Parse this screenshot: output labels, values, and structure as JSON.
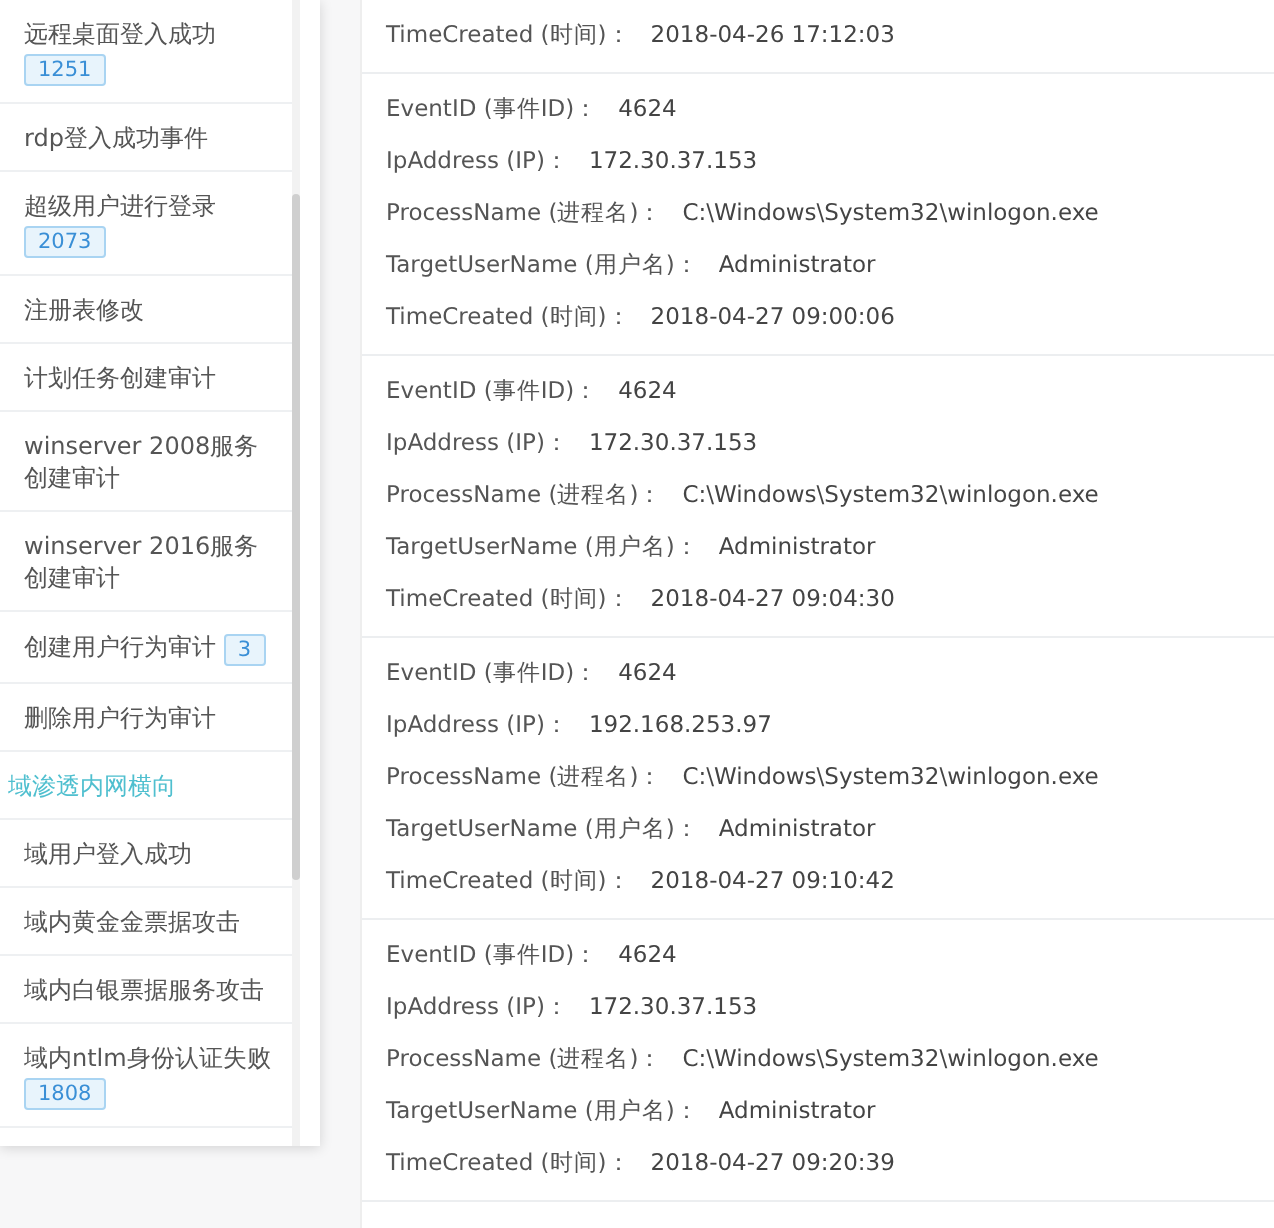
{
  "sidebar": {
    "items": [
      {
        "kind": "item",
        "label": "远程桌面登入成功",
        "badge": "1251"
      },
      {
        "kind": "item",
        "label": "rdp登入成功事件"
      },
      {
        "kind": "item",
        "label": "超级用户进行登录",
        "badge": "2073"
      },
      {
        "kind": "item",
        "label": "注册表修改"
      },
      {
        "kind": "item",
        "label": "计划任务创建审计"
      },
      {
        "kind": "item",
        "label": "winserver 2008服务创建审计"
      },
      {
        "kind": "item",
        "label": "winserver 2016服务创建审计"
      },
      {
        "kind": "item",
        "label": "创建用户行为审计",
        "badge": "3"
      },
      {
        "kind": "item",
        "label": "删除用户行为审计"
      },
      {
        "kind": "group",
        "label": "域渗透内网横向"
      },
      {
        "kind": "item",
        "label": "域用户登入成功"
      },
      {
        "kind": "item",
        "label": "域内黄金金票据攻击"
      },
      {
        "kind": "item",
        "label": "域内白银票据服务攻击"
      },
      {
        "kind": "item",
        "label": "域内ntlm身份认证失败",
        "badge": "1808"
      }
    ]
  },
  "events": [
    {
      "fields": [
        {
          "label": "TimeCreated (时间)：",
          "value": "2018-04-26 17:12:03"
        }
      ]
    },
    {
      "fields": [
        {
          "label": "EventID (事件ID)：",
          "value": "4624"
        },
        {
          "label": "IpAddress (IP)：",
          "value": "172.30.37.153"
        },
        {
          "label": "ProcessName (进程名)：",
          "value": "C:\\Windows\\System32\\winlogon.exe"
        },
        {
          "label": "TargetUserName (用户名)：",
          "value": "Administrator"
        },
        {
          "label": "TimeCreated (时间)：",
          "value": "2018-04-27 09:00:06"
        }
      ]
    },
    {
      "fields": [
        {
          "label": "EventID (事件ID)：",
          "value": "4624"
        },
        {
          "label": "IpAddress (IP)：",
          "value": "172.30.37.153"
        },
        {
          "label": "ProcessName (进程名)：",
          "value": "C:\\Windows\\System32\\winlogon.exe"
        },
        {
          "label": "TargetUserName (用户名)：",
          "value": "Administrator"
        },
        {
          "label": "TimeCreated (时间)：",
          "value": "2018-04-27 09:04:30"
        }
      ]
    },
    {
      "fields": [
        {
          "label": "EventID (事件ID)：",
          "value": "4624"
        },
        {
          "label": "IpAddress (IP)：",
          "value": "192.168.253.97"
        },
        {
          "label": "ProcessName (进程名)：",
          "value": "C:\\Windows\\System32\\winlogon.exe"
        },
        {
          "label": "TargetUserName (用户名)：",
          "value": "Administrator"
        },
        {
          "label": "TimeCreated (时间)：",
          "value": "2018-04-27 09:10:42"
        }
      ]
    },
    {
      "fields": [
        {
          "label": "EventID (事件ID)：",
          "value": "4624"
        },
        {
          "label": "IpAddress (IP)：",
          "value": "172.30.37.153"
        },
        {
          "label": "ProcessName (进程名)：",
          "value": "C:\\Windows\\System32\\winlogon.exe"
        },
        {
          "label": "TargetUserName (用户名)：",
          "value": "Administrator"
        },
        {
          "label": "TimeCreated (时间)：",
          "value": "2018-04-27 09:20:39"
        }
      ]
    }
  ]
}
